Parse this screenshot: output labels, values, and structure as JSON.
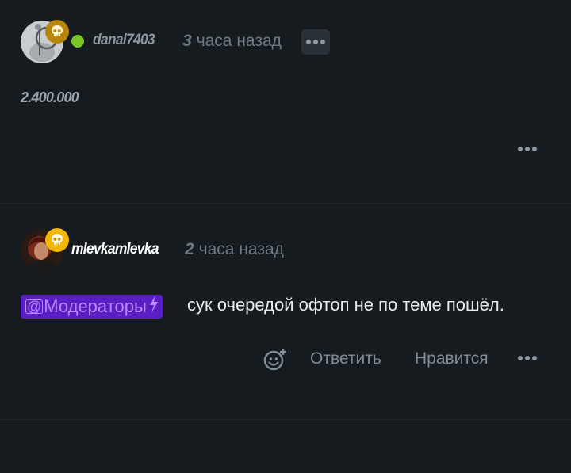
{
  "comments": [
    {
      "author": "danal7403",
      "time_num": "3",
      "time_text": "часа назад",
      "text": "2.400.000",
      "online": true,
      "menu_icon": "ellipsis-icon",
      "colors": {
        "author": "#8b969c",
        "badge": "#b8860b",
        "online": "#7ac629"
      }
    },
    {
      "author": "mlevkamlevka",
      "time_num": "2",
      "time_text": "часа назад",
      "mention": "Модераторы",
      "mention_at": "@",
      "text": "сук очередой офтоп не по теме пошёл.",
      "actions": {
        "reply": "Ответить",
        "like": "Нравится",
        "react_icon": "add-reaction-icon",
        "more_icon": "ellipsis-icon"
      },
      "colors": {
        "author": "#ffffff",
        "badge": "#f2b705",
        "mention_bg": "#5a1fc4",
        "mention_text": "#b788ff"
      }
    }
  ]
}
